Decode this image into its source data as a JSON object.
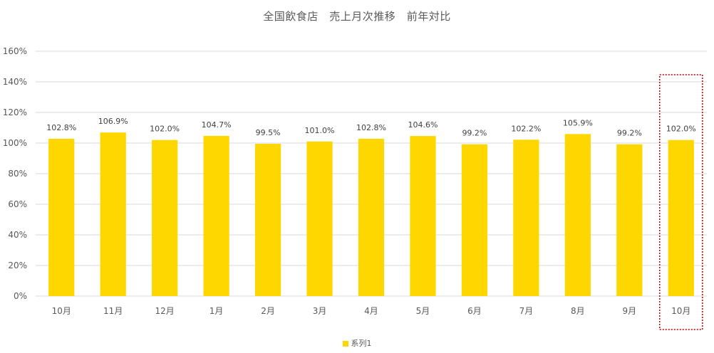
{
  "chart_data": {
    "type": "bar",
    "title": "全国飲食店　売上月次推移　前年対比",
    "categories": [
      "10月",
      "11月",
      "12月",
      "1月",
      "2月",
      "3月",
      "4月",
      "5月",
      "6月",
      "7月",
      "8月",
      "9月",
      "10月"
    ],
    "series": [
      {
        "name": "系列1",
        "values": [
          102.8,
          106.9,
          102.0,
          104.7,
          99.5,
          101.0,
          102.8,
          104.6,
          99.2,
          102.2,
          105.9,
          99.2,
          102.0
        ],
        "labels": [
          "102.8%",
          "106.9%",
          "102.0%",
          "104.7%",
          "99.5%",
          "101.0%",
          "102.8%",
          "104.6%",
          "99.2%",
          "102.2%",
          "105.9%",
          "99.2%",
          "102.0%"
        ]
      }
    ],
    "yticks": [
      "0%",
      "20%",
      "40%",
      "60%",
      "80%",
      "100%",
      "120%",
      "140%",
      "160%"
    ],
    "ylim": [
      0,
      160
    ],
    "grid": true,
    "legend_position": "bottom",
    "highlighted_category_index": 12,
    "colors": {
      "bar": "#FFD700",
      "grid": "#D9D9D9",
      "highlight_box": "#C00000"
    }
  }
}
